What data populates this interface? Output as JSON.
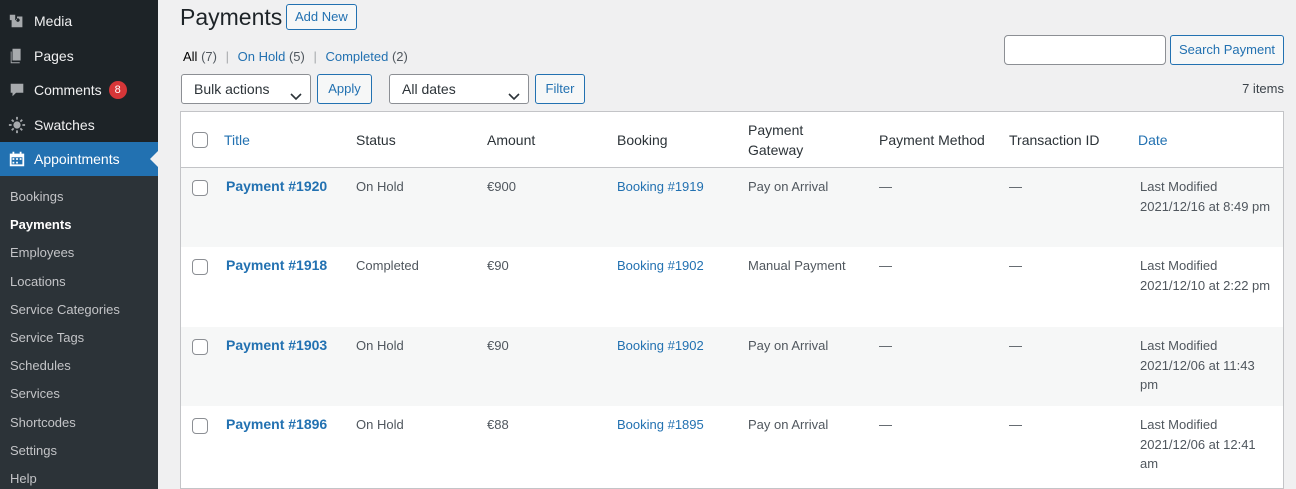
{
  "sidebar": {
    "items": [
      {
        "label": "Media",
        "icon": "media-icon"
      },
      {
        "label": "Pages",
        "icon": "pages-icon"
      },
      {
        "label": "Comments",
        "icon": "comments-icon",
        "badge": "8"
      },
      {
        "label": "Swatches",
        "icon": "gear-icon"
      },
      {
        "label": "Appointments",
        "icon": "calendar-icon"
      }
    ],
    "submenu": [
      "Bookings",
      "Payments",
      "Employees",
      "Locations",
      "Service Categories",
      "Service Tags",
      "Schedules",
      "Services",
      "Shortcodes",
      "Settings",
      "Help"
    ]
  },
  "header": {
    "title": "Payments",
    "add_new": "Add New"
  },
  "filters": {
    "all": "All",
    "all_count": "(7)",
    "on_hold": "On Hold",
    "on_hold_count": "(5)",
    "completed": "Completed",
    "completed_count": "(2)",
    "sep": "|"
  },
  "search": {
    "value": "",
    "button": "Search Payment"
  },
  "toolbar": {
    "bulk_actions": "Bulk actions",
    "apply": "Apply",
    "dates": "All dates",
    "filter": "Filter",
    "items": "7 items"
  },
  "table": {
    "headers": {
      "title": "Title",
      "status": "Status",
      "amount": "Amount",
      "booking": "Booking",
      "gateway_1": "Payment",
      "gateway_2": "Gateway",
      "method": "Payment Method",
      "transaction": "Transaction ID",
      "date": "Date"
    },
    "rows": [
      {
        "title": "Payment #1920",
        "status": "On Hold",
        "amount": "€900",
        "booking": "Booking #1919",
        "gateway": "Pay on Arrival",
        "method": "—",
        "transaction": "—",
        "date_1": "Last Modified",
        "date_2": "2021/12/16 at 8:49 pm",
        "date_3": ""
      },
      {
        "title": "Payment #1918",
        "status": "Completed",
        "amount": "€90",
        "booking": "Booking #1902",
        "gateway": "Manual Payment",
        "method": "—",
        "transaction": "—",
        "date_1": "Last Modified",
        "date_2": "2021/12/10 at 2:22 pm",
        "date_3": ""
      },
      {
        "title": "Payment #1903",
        "status": "On Hold",
        "amount": "€90",
        "booking": "Booking #1902",
        "gateway": "Pay on Arrival",
        "method": "—",
        "transaction": "—",
        "date_1": "Last Modified",
        "date_2": "2021/12/06 at 11:43",
        "date_3": "pm"
      },
      {
        "title": "Payment #1896",
        "status": "On Hold",
        "amount": "€88",
        "booking": "Booking #1895",
        "gateway": "Pay on Arrival",
        "method": "—",
        "transaction": "—",
        "date_1": "Last Modified",
        "date_2": "2021/12/06 at 12:41",
        "date_3": "am"
      }
    ]
  }
}
